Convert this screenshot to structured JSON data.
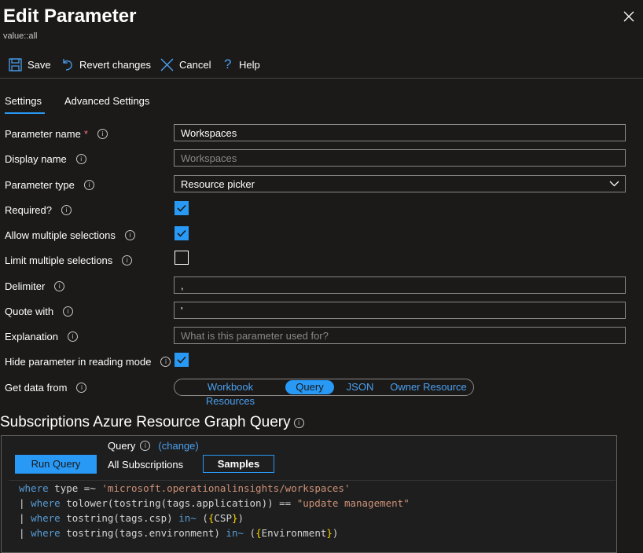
{
  "header": {
    "title": "Edit Parameter",
    "subtitle": "value::all"
  },
  "toolbar": {
    "save": "Save",
    "revert": "Revert changes",
    "cancel": "Cancel",
    "help": "Help"
  },
  "tabs": [
    "Settings",
    "Advanced Settings"
  ],
  "form": {
    "parameter_name": {
      "label": "Parameter name",
      "required_mark": "*",
      "value": "Workspaces"
    },
    "display_name": {
      "label": "Display name",
      "placeholder": "Workspaces"
    },
    "parameter_type": {
      "label": "Parameter type",
      "value": "Resource picker"
    },
    "required": {
      "label": "Required?",
      "checked": true
    },
    "allow_multiple": {
      "label": "Allow multiple selections",
      "checked": true
    },
    "limit_multiple": {
      "label": "Limit multiple selections",
      "checked": false
    },
    "delimiter": {
      "label": "Delimiter",
      "value": ","
    },
    "quote_with": {
      "label": "Quote with",
      "value": "'"
    },
    "explanation": {
      "label": "Explanation",
      "placeholder": "What is this parameter used for?"
    },
    "hide_reading": {
      "label": "Hide parameter in reading mode",
      "checked": true
    },
    "get_data_from": {
      "label": "Get data from",
      "options": [
        "Workbook Resources",
        "Query",
        "JSON",
        "Owner Resource"
      ],
      "selected": "Query"
    }
  },
  "query_section": {
    "title": "Subscriptions Azure Resource Graph Query",
    "run_button": "Run Query",
    "query_label": "Query",
    "change_link": "(change)",
    "scope": "All Subscriptions",
    "samples_button": "Samples",
    "code": [
      [
        "where",
        " type ",
        "=~",
        " ",
        "'microsoft.operationalinsights/workspaces'"
      ],
      [
        "| ",
        "where",
        " tolower(tostring(tags.application)) == ",
        "\"update management\""
      ],
      [
        "| ",
        "where",
        " tostring(tags.csp) ",
        "in~",
        " (",
        "{",
        "CSP",
        "}",
        ")"
      ],
      [
        "| ",
        "where",
        " tostring(tags.environment) ",
        "in~",
        " (",
        "{",
        "Environment",
        "}",
        ")"
      ]
    ]
  },
  "colors": {
    "background": "#1b1a19",
    "accent": "#2899f5",
    "keyword": "#569cd6",
    "string": "#ce9178",
    "required": "#f1707b"
  }
}
